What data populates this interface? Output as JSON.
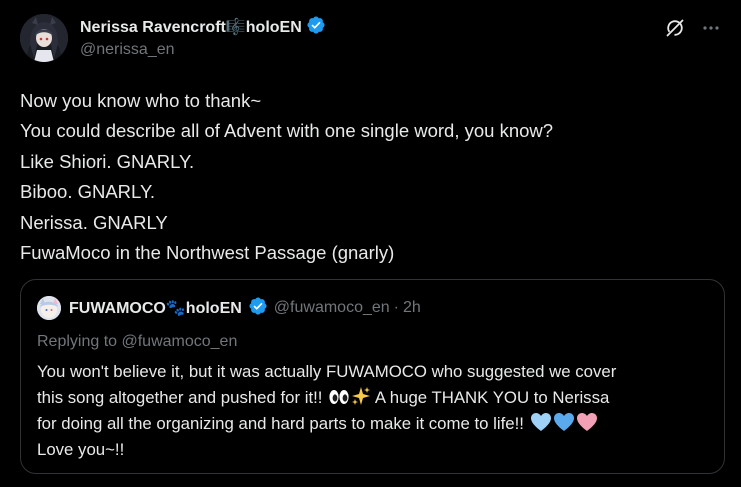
{
  "author": {
    "display_name": "Nerissa Ravencroft🎼holoEN",
    "handle": "@nerissa_en",
    "verified": true,
    "badge_color": "#1d9bf0"
  },
  "tweet": {
    "lines": [
      "Now you know who to thank~",
      "You could describe all of Advent with one single word, you know?",
      "Like Shiori. GNARLY.",
      "Biboo. GNARLY.",
      "Nerissa. GNARLY",
      "FuwaMoco in the Northwest Passage (gnarly)"
    ]
  },
  "header_actions": {
    "grok_icon": "grok-icon",
    "more_icon": "more-icon"
  },
  "quote": {
    "display_name": "FUWAMOCO🐾holoEN",
    "handle": "@fuwamoco_en",
    "separator": "·",
    "time": "2h",
    "verified": true,
    "replying_to": "Replying to @fuwamoco_en",
    "lines": [
      "You won't believe it, but it was actually FUWAMOCO who suggested we cover",
      "this song altogether and pushed for it!! ",
      " A huge THANK YOU to Nerissa",
      "for doing all the organizing and hard parts to make it come to life!! ",
      "Love you~!!"
    ],
    "emojis": [
      "eyes",
      "sparkles",
      "light-blue-heart",
      "light-blue-heart",
      "pink-heart"
    ]
  },
  "colors": {
    "background": "#000000",
    "text": "#e7e9ea",
    "secondary": "#71767b",
    "border": "#2f3336",
    "verified": "#1d9bf0"
  }
}
